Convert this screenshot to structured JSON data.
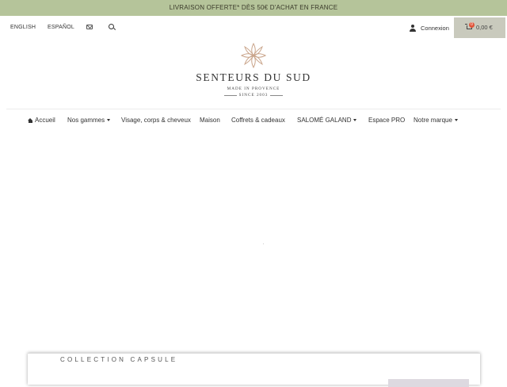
{
  "promo": {
    "text": "LIVRAISON OFFERTE* DÈS 50€ D'ACHAT EN FRANCE"
  },
  "topbar": {
    "languages": [
      "ENGLISH",
      "ESPAÑOL"
    ],
    "icons": {
      "mail": "mail-icon",
      "search": "search-icon",
      "user": "user-icon",
      "cart": "cart-icon"
    },
    "login_label": "Connexion",
    "cart_count": "0",
    "cart_total": "0,00 €"
  },
  "logo": {
    "title": "SENTEURS DU SUD",
    "line1": "MADE IN PROVENCE",
    "line2": "SINCE 2003"
  },
  "nav": {
    "items": [
      {
        "label": "Accueil",
        "icon": "home-icon",
        "dropdown": false
      },
      {
        "label": "Nos gammes",
        "dropdown": true
      },
      {
        "label": "Visage, corps & cheveux",
        "dropdown": false
      },
      {
        "label": "Maison",
        "dropdown": false
      },
      {
        "label": "Coffrets & cadeaux",
        "dropdown": false
      },
      {
        "label": "SALOMÉ GALAND",
        "dropdown": true
      },
      {
        "label": "Espace PRO",
        "dropdown": false
      },
      {
        "label": "Notre marque",
        "dropdown": true
      }
    ]
  },
  "card": {
    "title": "COLLECTION CAPSULE"
  },
  "colors": {
    "promo_bg": "#b5c49a",
    "cart_bg": "#c9cabd",
    "badge": "#e0553a",
    "logo_accent": "#c9a48a"
  }
}
